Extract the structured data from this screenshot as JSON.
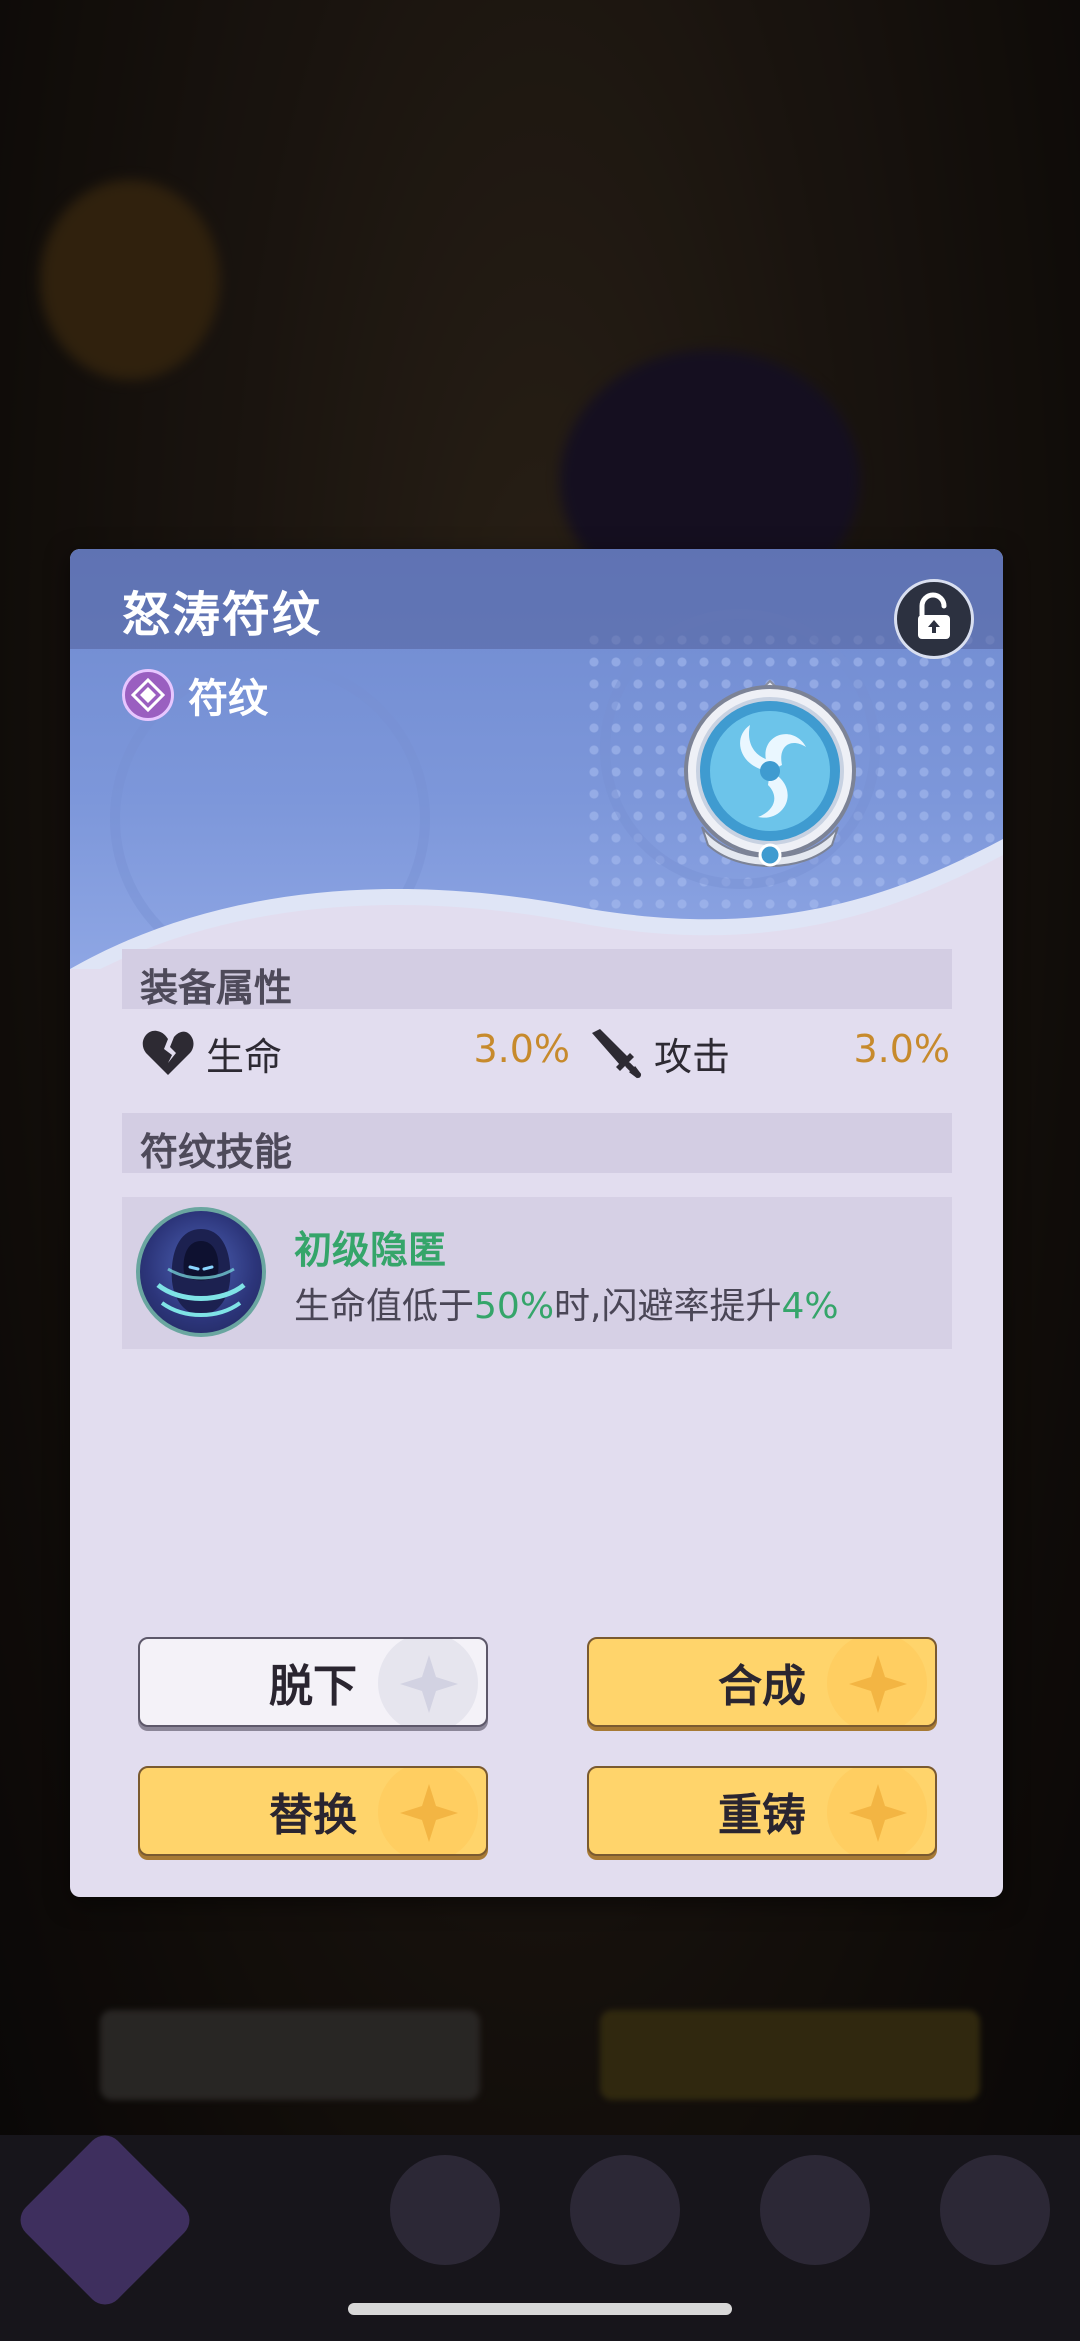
{
  "dialog": {
    "title": "怒涛符纹",
    "category": "符纹",
    "icons": {
      "lock": "unlock-icon",
      "category": "rune-category-icon",
      "emblem": "swirl-rune-emblem"
    }
  },
  "attributes": {
    "header": "装备属性",
    "items": [
      {
        "icon": "broken-heart-icon",
        "label": "生命",
        "value": "3.0%"
      },
      {
        "icon": "sword-icon",
        "label": "攻击",
        "value": "3.0%"
      }
    ]
  },
  "skills": {
    "header": "符纹技能",
    "items": [
      {
        "icon": "hooded-figure-icon",
        "name": "初级隐匿",
        "desc_parts": [
          "生命值低于",
          "50%",
          "时,闪避率提升",
          "4%"
        ]
      }
    ]
  },
  "buttons": {
    "unequip": "脱下",
    "combine": "合成",
    "replace": "替换",
    "reforge": "重铸"
  },
  "colors": {
    "accent_green": "#35a56a",
    "value_orange": "#c78a2c",
    "button_yellow": "#ffd46b",
    "banner_blue": "#7d97da"
  }
}
